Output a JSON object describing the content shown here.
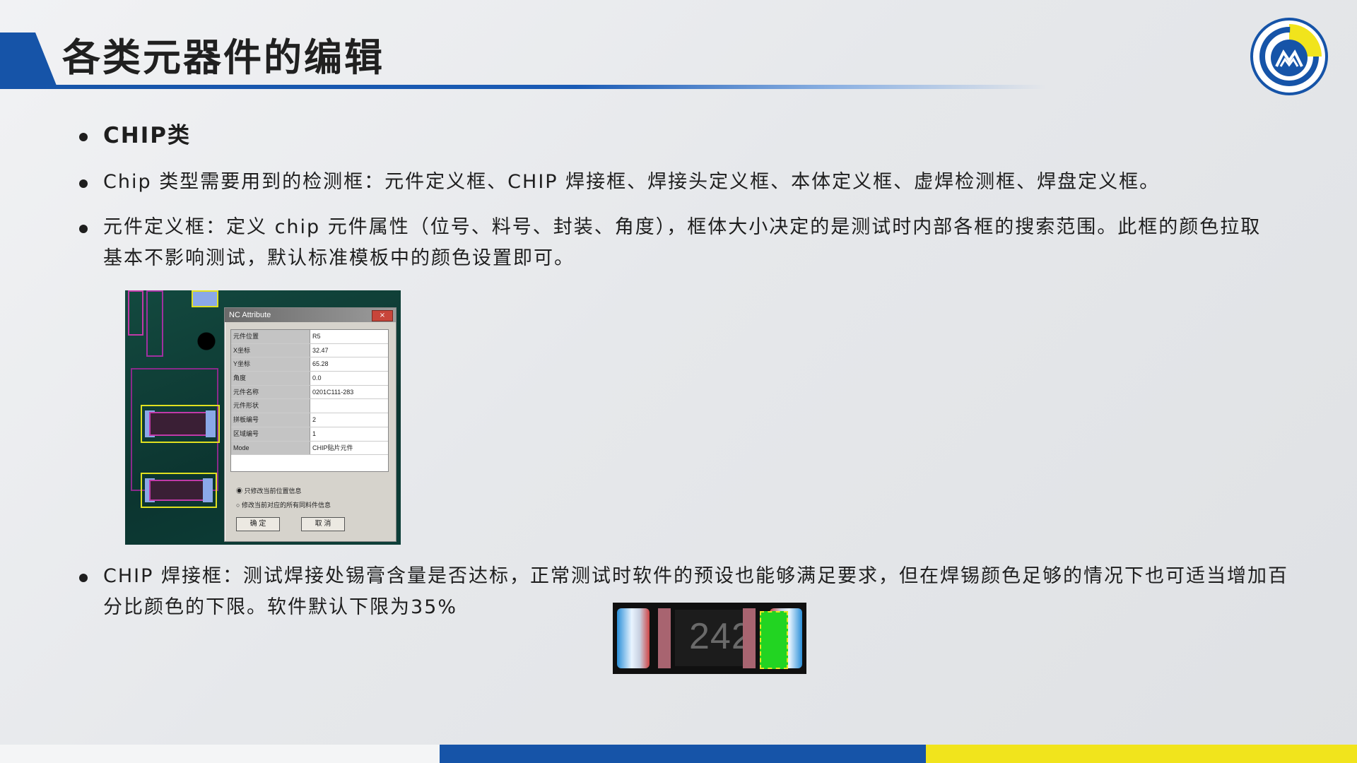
{
  "title": "各类元器件的编辑",
  "bullets": {
    "b1": "CHIP类",
    "b2": "Chip 类型需要用到的检测框：元件定义框、CHIP 焊接框、焊接头定义框、本体定义框、虚焊检测框、焊盘定义框。",
    "b3": "元件定义框：定义 chip 元件属性（位号、料号、封装、角度），框体大小决定的是测试时内部各框的搜索范围。此框的颜色拉取基本不影响测试，默认标准模板中的颜色设置即可。",
    "b4": "CHIP 焊接框：测试焊接处锡膏含量是否达标，正常测试时软件的预设也能够满足要求，但在焊锡颜色足够的情况下也可适当增加百分比颜色的下限。软件默认下限为35%"
  },
  "dialog": {
    "title": "NC Attribute",
    "close": "×",
    "rows": [
      {
        "k": "元件位置",
        "v": "R5"
      },
      {
        "k": "X坐标",
        "v": "32.47"
      },
      {
        "k": "Y坐标",
        "v": "65.28"
      },
      {
        "k": "角度",
        "v": "0.0"
      },
      {
        "k": "元件名称",
        "v": "0201C111-283"
      },
      {
        "k": "元件形状",
        "v": ""
      },
      {
        "k": "拼板编号",
        "v": "2"
      },
      {
        "k": "区域编号",
        "v": "1"
      },
      {
        "k": "Mode",
        "v": "CHIP贴片元件"
      }
    ],
    "option1": "只修改当前位置信息",
    "option2": "修改当前对应的所有同料件信息",
    "ok": "确  定",
    "cancel": "取  消"
  },
  "chip_marking": "242",
  "colors": {
    "accent_blue": "#1654a8",
    "accent_yellow": "#f1e41c"
  }
}
